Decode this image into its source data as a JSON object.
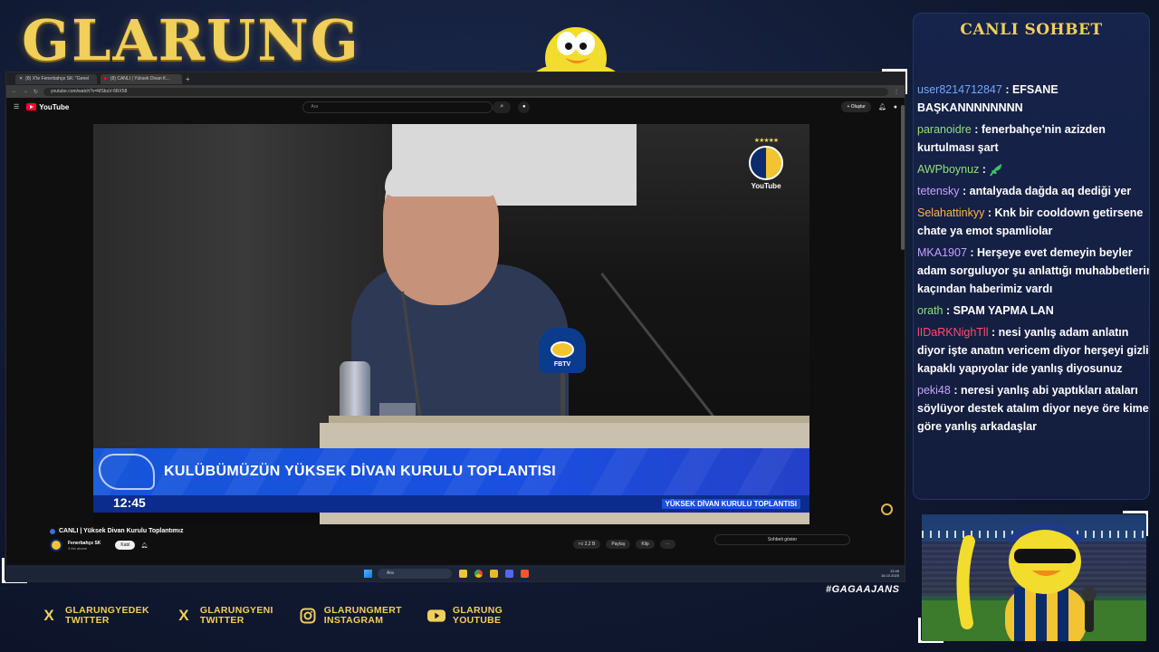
{
  "overlay": {
    "brand": "GLARUNG",
    "hashtag": "#GAGAAJANS",
    "socials": [
      {
        "icon": "x-icon",
        "line1": "GLARUNGYEDEK",
        "line2": "TWITTER"
      },
      {
        "icon": "x-icon",
        "line1": "GLARUNGYENI",
        "line2": "TWITTER"
      },
      {
        "icon": "instagram-icon",
        "line1": "GLARUNGMERT",
        "line2": "INSTAGRAM"
      },
      {
        "icon": "youtube-icon",
        "line1": "GLARUNG",
        "line2": "YOUTUBE"
      }
    ]
  },
  "browser": {
    "tabs": [
      {
        "label": "(8) X'te Fenerbahçe SK: \"Genel"
      },
      {
        "label": "(8) CANLI | Yüksek Divan K…"
      }
    ],
    "url": "youtube.com/watch?v=MSbuV-6RX58"
  },
  "youtube": {
    "logo": "YouTube",
    "search_placeholder": "Ara",
    "create_label": "+ Oluştur",
    "player": {
      "badge_label": "YouTube",
      "fbtv": "FBTV",
      "banner_title": "KULÜBÜMÜZÜN YÜKSEK DİVAN KURULU TOPLANTISI",
      "clock": "12:45",
      "caption": "YÜKSEK DİVAN KURULU TOPLANTISI"
    },
    "video_title": "CANLI | Yüksek Divan Kurulu Toplantımız",
    "channel_name": "Fenerbahçe SK",
    "channel_subs": "3 Mn abone",
    "join_label": "Katıl",
    "actions": {
      "likes": "2,2 B",
      "share": "Paylaş",
      "clip": "Klip"
    },
    "chat_toggle": "Sohbeti göster"
  },
  "taskbar": {
    "search_placeholder": "Ara",
    "time": "12:45",
    "date": "16.10.2025"
  },
  "chat": {
    "title": "CANLI SOHBET",
    "messages": [
      {
        "user": "user8214712847",
        "color": "#6fa8ff",
        "text": "EFSANE BAŞKANNNNNNNN"
      },
      {
        "user": "paranoidre",
        "color": "#8fe07a",
        "text": "fenerbahçe'nin azizden kurtulması şart"
      },
      {
        "user": "AWPboynuz",
        "color": "#8fe07a",
        "text": "",
        "emote": "plant-emote-icon"
      },
      {
        "user": "tetensky",
        "color": "#c9a2ff",
        "text": "antalyada dağda aq dediği yer"
      },
      {
        "user": "Selahattinkyy",
        "color": "#ffb347",
        "text": "Knk bir cooldown getirsene chate ya emot spamliolar"
      },
      {
        "user": "MKA1907",
        "color": "#c9a2ff",
        "text": "Herşeye evet demeyin beyler adam sorguluyor şu anlattığı muhabbetlerin kaçından haberimiz vardı"
      },
      {
        "user": "orath",
        "color": "#8fe07a",
        "text": "SPAM YAPMA LAN"
      },
      {
        "user": "lIDaRKNighTll",
        "color": "#ff4d6d",
        "text": "nesi yanlış adam anlatın diyor işte anatın vericem diyor herşeyi gizli kapaklı yapıyolar ide yanlış diyosunuz"
      },
      {
        "user": "peki48",
        "color": "#c9a2ff",
        "text": "neresi yanlış abi yaptıkları ataları söylüyor destek atalım diyor neye öre kime göre yanlış arkadaşlar"
      }
    ]
  }
}
